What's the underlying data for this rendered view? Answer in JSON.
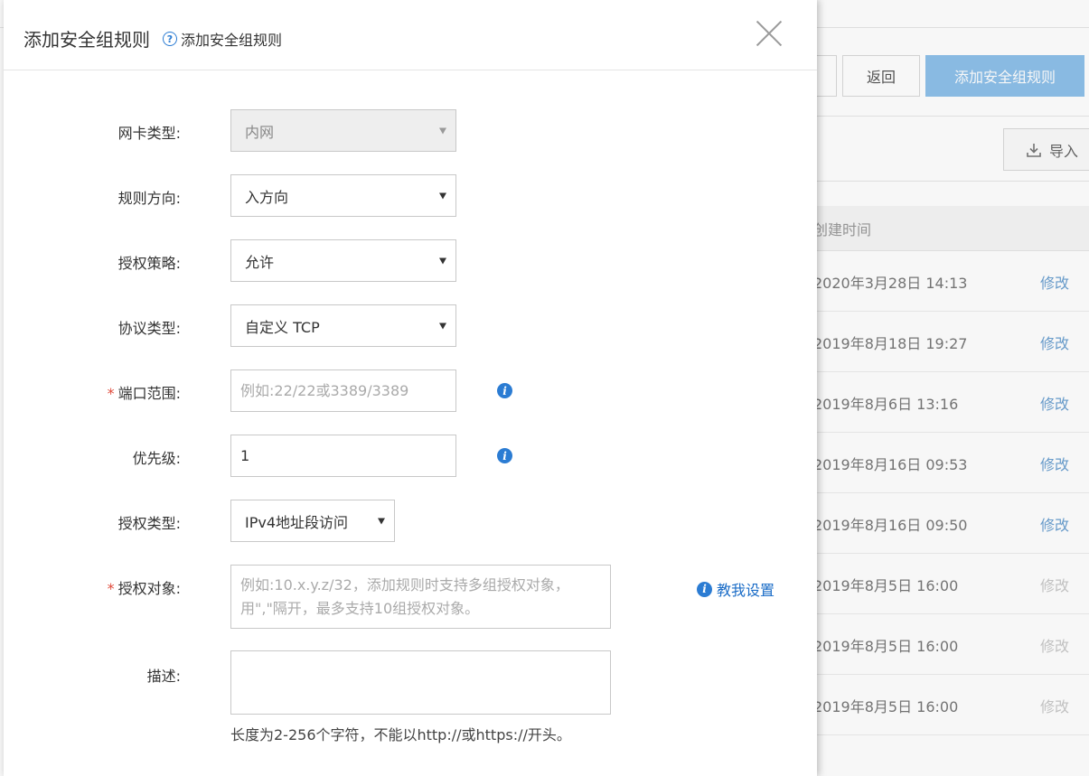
{
  "background": {
    "buttons": {
      "back": "返回",
      "add": "添加安全组规则"
    },
    "import_label": "导入",
    "table": {
      "header": "创建时间",
      "rows": [
        {
          "time": "2020年3月28日 14:13",
          "action": "修改",
          "disabled": false
        },
        {
          "time": "2019年8月18日 19:27",
          "action": "修改",
          "disabled": false
        },
        {
          "time": "2019年8月6日 13:16",
          "action": "修改",
          "disabled": false
        },
        {
          "time": "2019年8月16日 09:53",
          "action": "修改",
          "disabled": false
        },
        {
          "time": "2019年8月16日 09:50",
          "action": "修改",
          "disabled": false
        },
        {
          "time": "2019年8月5日 16:00",
          "action": "修改",
          "disabled": true
        },
        {
          "time": "2019年8月5日 16:00",
          "action": "修改",
          "disabled": true
        },
        {
          "time": "2019年8月5日 16:00",
          "action": "修改",
          "disabled": true
        }
      ]
    }
  },
  "dialog": {
    "title": "添加安全组规则",
    "help_link": "添加安全组规则",
    "fields": {
      "nic_type": {
        "label": "网卡类型:",
        "value": "内网"
      },
      "direction": {
        "label": "规则方向:",
        "value": "入方向"
      },
      "policy": {
        "label": "授权策略:",
        "value": "允许"
      },
      "protocol": {
        "label": "协议类型:",
        "value": "自定义 TCP"
      },
      "port_range": {
        "label": "端口范围:",
        "required": "*",
        "placeholder": "例如:22/22或3389/3389"
      },
      "priority": {
        "label": "优先级:",
        "value": "1"
      },
      "auth_type": {
        "label": "授权类型:",
        "value": "IPv4地址段访问"
      },
      "auth_object": {
        "label": "授权对象:",
        "required": "*",
        "placeholder_line1": "例如:10.x.y.z/32，添加规则时支持多组授权对象，",
        "placeholder_line2": "用\",\"隔开，最多支持10组授权对象。",
        "teach_link": "教我设置"
      },
      "description": {
        "label": "描述:",
        "hint": "长度为2-256个字符，不能以http://或https://开头。"
      }
    }
  },
  "colors": {
    "primary": "#8ec0ea",
    "link": "#1a6cc7",
    "info_icon": "#2b7cd3",
    "required": "#e04a3b"
  }
}
